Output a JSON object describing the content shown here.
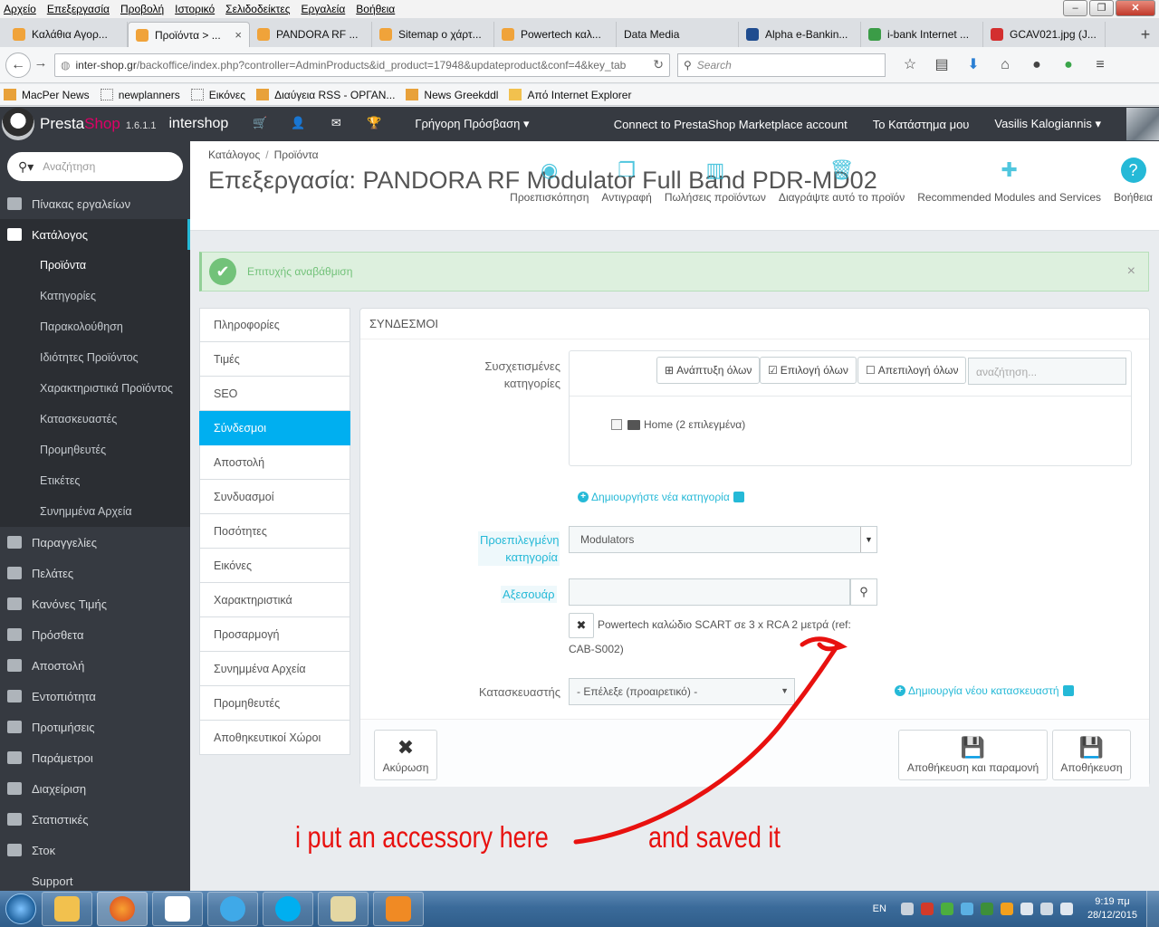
{
  "browser": {
    "menu": [
      "Αρχείο",
      "Επεξεργασία",
      "Προβολή",
      "Ιστορικό",
      "Σελιδοδείκτες",
      "Εργαλεία",
      "Βοήθεια"
    ],
    "tabs": [
      {
        "label": "Καλάθια Αγορ...",
        "color": "#f0a33a"
      },
      {
        "label": "Προϊόντα > ...",
        "color": "#f0a33a",
        "active": true
      },
      {
        "label": "PANDORA RF ...",
        "color": "#f0a33a"
      },
      {
        "label": "Sitemap ο χάρτ...",
        "color": "#f0a33a"
      },
      {
        "label": "Powertech καλ...",
        "color": "#f0a33a"
      },
      {
        "label": "Data Media",
        "color": ""
      },
      {
        "label": "Alpha e-Bankin...",
        "color": "#1f4c8f"
      },
      {
        "label": "i-bank Internet ...",
        "color": "#3b9c47"
      },
      {
        "label": "GCAV021.jpg (J...",
        "color": "#d32f2f"
      }
    ],
    "tab_close": "×",
    "new_tab": "+",
    "url_prefix": "inter-shop.gr",
    "url_rest": "/backoffice/index.php?controller=AdminProducts&id_product=17948&updateproduct&conf=4&key_tab",
    "search_placeholder": "Search",
    "bookmarks": [
      "MacPer News",
      "newplanners",
      "Εικόνες",
      "Διαύγεια RSS - ΟΡΓΑΝ...",
      "News Greekddl",
      "Από Internet Explorer"
    ]
  },
  "ps_header": {
    "brand_a": "Presta",
    "brand_b": "Shop",
    "version": "1.6.1.1",
    "shop_name": "intershop",
    "quick_access": "Γρήγορη Πρόσβαση ▾",
    "connect": "Connect to PrestaShop Marketplace account",
    "my_shop": "Το Κατάστημα μου",
    "user": "Vasilis Kalogiannis ▾"
  },
  "sidebar": {
    "search_placeholder": "Αναζήτηση",
    "items": [
      {
        "label": "Πίνακας εργαλείων"
      },
      {
        "label": "Κατάλογος",
        "active": true
      },
      {
        "label": "Παραγγελίες"
      },
      {
        "label": "Πελάτες"
      },
      {
        "label": "Κανόνες Τιμής"
      },
      {
        "label": "Πρόσθετα"
      },
      {
        "label": "Αποστολή"
      },
      {
        "label": "Εντοπιότητα"
      },
      {
        "label": "Προτιμήσεις"
      },
      {
        "label": "Παράμετροι"
      },
      {
        "label": "Διαχείριση"
      },
      {
        "label": "Στατιστικές"
      },
      {
        "label": "Στοκ"
      }
    ],
    "sub_items": [
      "Προϊόντα",
      "Κατηγορίες",
      "Παρακολούθηση",
      "Ιδιότητες Προϊόντος",
      "Χαρακτηριστικά Προϊόντος",
      "Κατασκευαστές",
      "Προμηθευτές",
      "Ετικέτες",
      "Συνημμένα Αρχεία"
    ],
    "support": "Support"
  },
  "page": {
    "breadcrumb": [
      "Κατάλογος",
      "Προϊόντα"
    ],
    "title": "Επεξεργασία: PANDORA RF Modulator Full Band PDR-MD02",
    "toolbar": [
      "Προεπισκόπηση",
      "Αντιγραφή",
      "Πωλήσεις προϊόντων",
      "Διαγράψτε αυτό το προϊόν",
      "Recommended Modules and Services",
      "Βοήθεια"
    ],
    "alert": "Επιτυχής αναβάθμιση"
  },
  "product_tabs": [
    "Πληροφορίες",
    "Τιμές",
    "SEO",
    "Σύνδεσμοι",
    "Αποστολή",
    "Συνδυασμοί",
    "Ποσότητες",
    "Εικόνες",
    "Χαρακτηριστικά",
    "Προσαρμογή",
    "Συνημμένα Αρχεία",
    "Προμηθευτές",
    "Αποθηκευτικοί Χώροι"
  ],
  "links_panel": {
    "heading": "ΣΥΝΔΕΣΜΟΙ",
    "assoc_label_1": "Συσχετισμένες",
    "assoc_label_2": "κατηγορίες",
    "expand_all": "Ανάπτυξη όλων",
    "select_all": "Επιλογή όλων",
    "deselect_all": "Απεπιλογή όλων",
    "tree_search_placeholder": "αναζήτηση...",
    "tree_root": "Home (2 επιλεγμένα)",
    "new_category": "Δημιουργήστε νέα κατηγορία",
    "default_cat_label_1": "Προεπιλεγμένη",
    "default_cat_label_2": "κατηγορία",
    "default_cat_value": "Modulators",
    "accessories_label": "Αξεσουάρ",
    "accessory_item": "Powertech καλώδιο SCART σε 3 x RCA 2 μετρά (ref: CAB-S002)",
    "manufacturer_label": "Κατασκευαστής",
    "manufacturer_value": "- Επέλεξε (προαιρετικό) -",
    "new_manufacturer": "Δημιουργία νέου κατασκευαστή",
    "cancel": "Ακύρωση",
    "save_stay": "Αποθήκευση και παραμονή",
    "save": "Αποθήκευση"
  },
  "annotation": {
    "left": "i put an accessory here",
    "right": "and saved it",
    "color": "#e8110f"
  },
  "taskbar": {
    "lang": "EN",
    "time": "9:19 πμ",
    "date": "28/12/2015"
  }
}
